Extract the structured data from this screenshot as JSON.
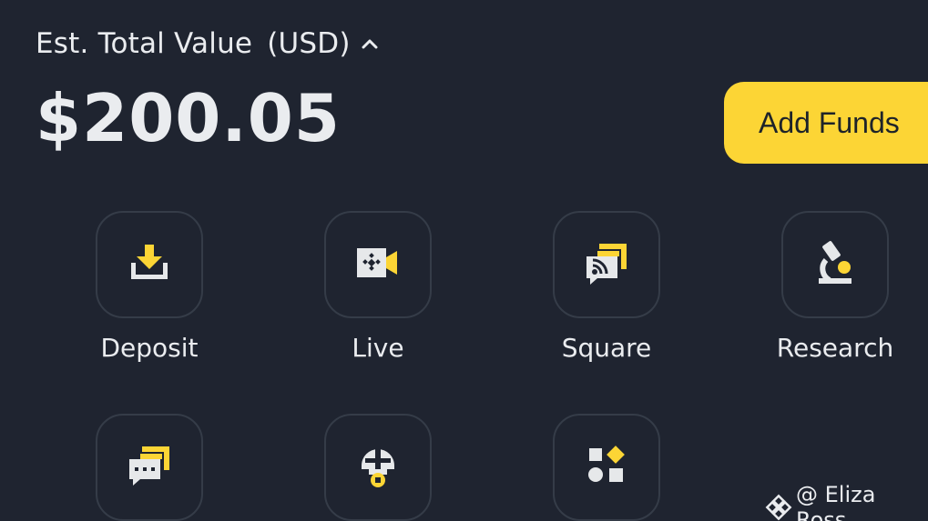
{
  "header": {
    "est_label": "Est. Total Value",
    "currency": "(USD)",
    "chevron_icon": "chevron-up-icon",
    "total_value": "$200.05"
  },
  "actions": {
    "add_funds_label": "Add Funds"
  },
  "shortcuts": [
    {
      "label": "Deposit",
      "icon": "deposit-icon"
    },
    {
      "label": "Live",
      "icon": "live-icon"
    },
    {
      "label": "Square",
      "icon": "square-icon"
    },
    {
      "label": "Research",
      "icon": "research-icon"
    },
    {
      "label": "",
      "icon": "chat-icon"
    },
    {
      "label": "",
      "icon": "mascot-icon"
    },
    {
      "label": "",
      "icon": "more-apps-icon"
    }
  ],
  "watermark": {
    "text": "@ Eliza Ross",
    "icon": "binance-logo-icon"
  },
  "colors": {
    "background": "#1f2430",
    "accent_yellow": "#fcd535",
    "icon_gray": "#e6e8ea",
    "text": "#eaecef",
    "tile_border": "#353c48"
  }
}
